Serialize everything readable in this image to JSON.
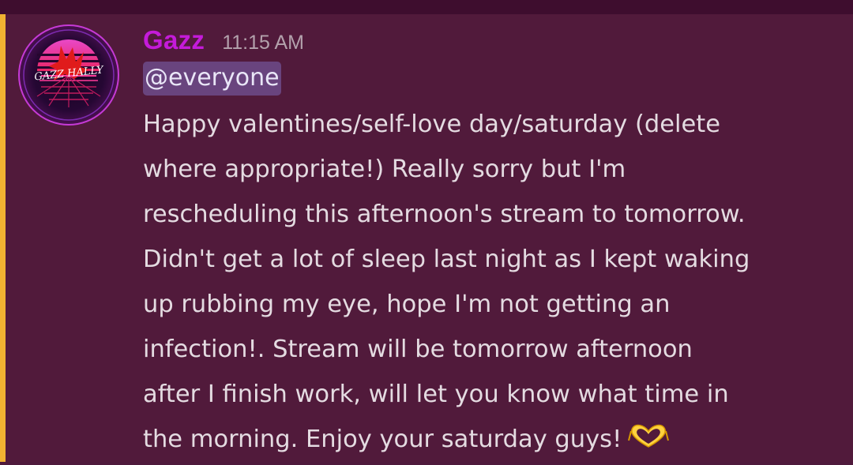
{
  "message": {
    "author": "Gazz",
    "timestamp": "11:15 AM",
    "avatar_text": "GAZZ HALLY",
    "mention": "@everyone",
    "lines": [
      "Happy valentines/self-love day/saturday (delete",
      "where appropriate!) Really sorry but I'm",
      "rescheduling this afternoon's stream to tomorrow.",
      "Didn't get a lot of sleep last night as I kept waking",
      "up rubbing my eye, hope I'm not getting an",
      "infection!. Stream will be tomorrow afternoon",
      "after I finish work, will let you know what time in",
      "the morning. Enjoy your saturday guys!"
    ],
    "emoji": "heart-hands-icon"
  },
  "colors": {
    "background": "#511a3b",
    "mention_stripe": "#f0b232",
    "author": "#c41bd9",
    "mention_bg": "#69447e",
    "text": "#e4dbe1"
  }
}
